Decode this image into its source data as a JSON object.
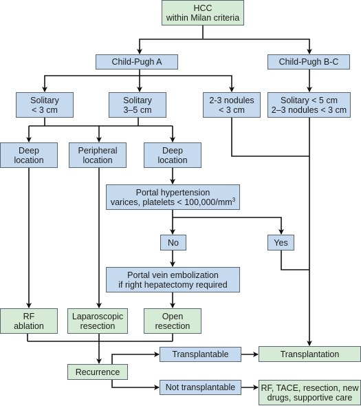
{
  "colors": {
    "decision": "#c6daef",
    "outcome": "#d6ebd5",
    "line": "#111111",
    "border": "#5a6470"
  },
  "nodes": {
    "hcc": {
      "lines": [
        "HCC",
        "within Milan criteria"
      ]
    },
    "child_pugh_a": {
      "lines": [
        "Child-Pugh A"
      ]
    },
    "child_pugh_bc": {
      "lines": [
        "Child-Pugh B-C"
      ]
    },
    "solitary_lt3": {
      "lines": [
        "Solitary",
        "< 3 cm"
      ]
    },
    "solitary_3_5": {
      "lines": [
        "Solitary",
        "3–5 cm"
      ]
    },
    "nodules_2_3": {
      "lines": [
        "2-3 nodules",
        "< 3 cm"
      ]
    },
    "bc_criteria": {
      "lines": [
        "Solitary < 5 cm",
        "2–3 nodules < 3 cm"
      ]
    },
    "deep_location_1": {
      "lines": [
        "Deep",
        "location"
      ]
    },
    "peripheral_location": {
      "lines": [
        "Peripheral",
        "location"
      ]
    },
    "deep_location_2": {
      "lines": [
        "Deep",
        "location"
      ]
    },
    "portal_hypertension": {
      "lines": [
        "Portal hypertension",
        "varices, platelets < 100,000/mm"
      ],
      "superscript": "3"
    },
    "no": {
      "lines": [
        "No"
      ]
    },
    "yes": {
      "lines": [
        "Yes"
      ]
    },
    "portal_vein_embolization": {
      "lines": [
        "Portal vein embolization",
        "if right hepatectomy required"
      ]
    },
    "rf_ablation": {
      "lines": [
        "RF",
        "ablation"
      ]
    },
    "laparoscopic_resection": {
      "lines": [
        "Laparoscopic",
        "resection"
      ]
    },
    "open_resection": {
      "lines": [
        "Open",
        "resection"
      ]
    },
    "recurrence": {
      "lines": [
        "Recurrence"
      ]
    },
    "transplantable": {
      "lines": [
        "Transplantable"
      ]
    },
    "not_transplantable": {
      "lines": [
        "Not transplantable"
      ]
    },
    "transplantation": {
      "lines": [
        "Transplantation"
      ]
    },
    "other_treatments": {
      "lines": [
        "RF, TACE, resection, new",
        "drugs, supportive care"
      ]
    }
  },
  "edges": [
    [
      "hcc",
      "child_pugh_a"
    ],
    [
      "hcc",
      "child_pugh_bc"
    ],
    [
      "child_pugh_a",
      "solitary_lt3"
    ],
    [
      "child_pugh_a",
      "solitary_3_5"
    ],
    [
      "child_pugh_a",
      "nodules_2_3"
    ],
    [
      "child_pugh_bc",
      "bc_criteria"
    ],
    [
      "solitary_lt3",
      "deep_location_1"
    ],
    [
      "solitary_lt3",
      "peripheral_location"
    ],
    [
      "solitary_lt3",
      "deep_location_2"
    ],
    [
      "solitary_3_5",
      "deep_location_1"
    ],
    [
      "solitary_3_5",
      "peripheral_location"
    ],
    [
      "solitary_3_5",
      "deep_location_2"
    ],
    [
      "nodules_2_3",
      "transplantation"
    ],
    [
      "bc_criteria",
      "transplantation"
    ],
    [
      "deep_location_1",
      "rf_ablation"
    ],
    [
      "peripheral_location",
      "laparoscopic_resection"
    ],
    [
      "deep_location_2",
      "portal_hypertension"
    ],
    [
      "portal_hypertension",
      "no"
    ],
    [
      "portal_hypertension",
      "yes"
    ],
    [
      "no",
      "portal_vein_embolization"
    ],
    [
      "yes",
      "transplantation"
    ],
    [
      "portal_vein_embolization",
      "open_resection"
    ],
    [
      "rf_ablation",
      "recurrence"
    ],
    [
      "laparoscopic_resection",
      "recurrence"
    ],
    [
      "open_resection",
      "recurrence"
    ],
    [
      "recurrence",
      "transplantable"
    ],
    [
      "recurrence",
      "not_transplantable"
    ],
    [
      "transplantable",
      "transplantation"
    ],
    [
      "not_transplantable",
      "other_treatments"
    ]
  ]
}
